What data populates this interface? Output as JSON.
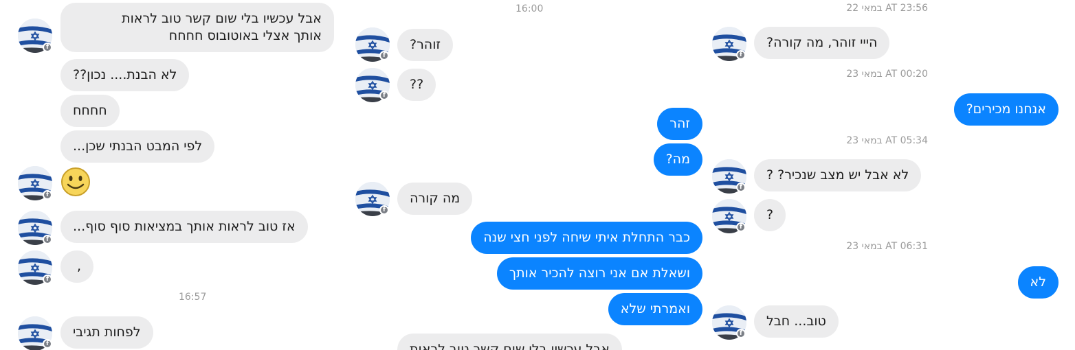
{
  "left": {
    "messages": [
      {
        "text": "אבל עכשיו בלי שום קשר טוב לראות\nאותך אצלי באוטובוס חחחח"
      },
      {
        "text": "לא הבנת.... נכון??"
      },
      {
        "text": "חחחח"
      },
      {
        "text": "לפי המבט הבנתי שכן..."
      },
      {
        "text": "אז טוב לראות אותך במציאות סוף סוף..."
      },
      {
        "text": ","
      },
      {
        "text": "לפחות תגיבי"
      }
    ],
    "emoji": "smiley-face",
    "time_divider": "16:57"
  },
  "middle": {
    "time_divider": "16:00",
    "messages": [
      {
        "text": "זוהר?"
      },
      {
        "text": "??"
      },
      {
        "text": "זהר"
      },
      {
        "text": "מה?"
      },
      {
        "text": "מה קורה"
      },
      {
        "text": "כבר התחלת איתי שיחה לפני חצי שנה"
      },
      {
        "text": "ושאלת אם אני רוצה להכיר אותך"
      },
      {
        "text": "ואמרתי שלא"
      },
      {
        "text": "אבל עכשיו בלי שום קשר טוב לראות"
      }
    ]
  },
  "right": {
    "timestamps": [
      "22 במאי AT 23:56",
      "23 במאי AT 00:20",
      "23 במאי AT 05:34",
      "23 במאי AT 06:31"
    ],
    "messages": [
      {
        "text": "הייי זוהר, מה קורה?"
      },
      {
        "text": "אנחנו מכירים?"
      },
      {
        "text": "לא אבל יש מצב שנכיר? ?"
      },
      {
        "text": "?"
      },
      {
        "text": "לא"
      },
      {
        "text": "טוב... חבל"
      }
    ]
  },
  "colors": {
    "sent_bubble": "#0b84ff",
    "received_bubble": "#ececed",
    "meta_text": "#9a9a9a"
  },
  "icons": {
    "avatar": "israeli-flag-avatar",
    "badge": "facebook-badge-icon"
  }
}
